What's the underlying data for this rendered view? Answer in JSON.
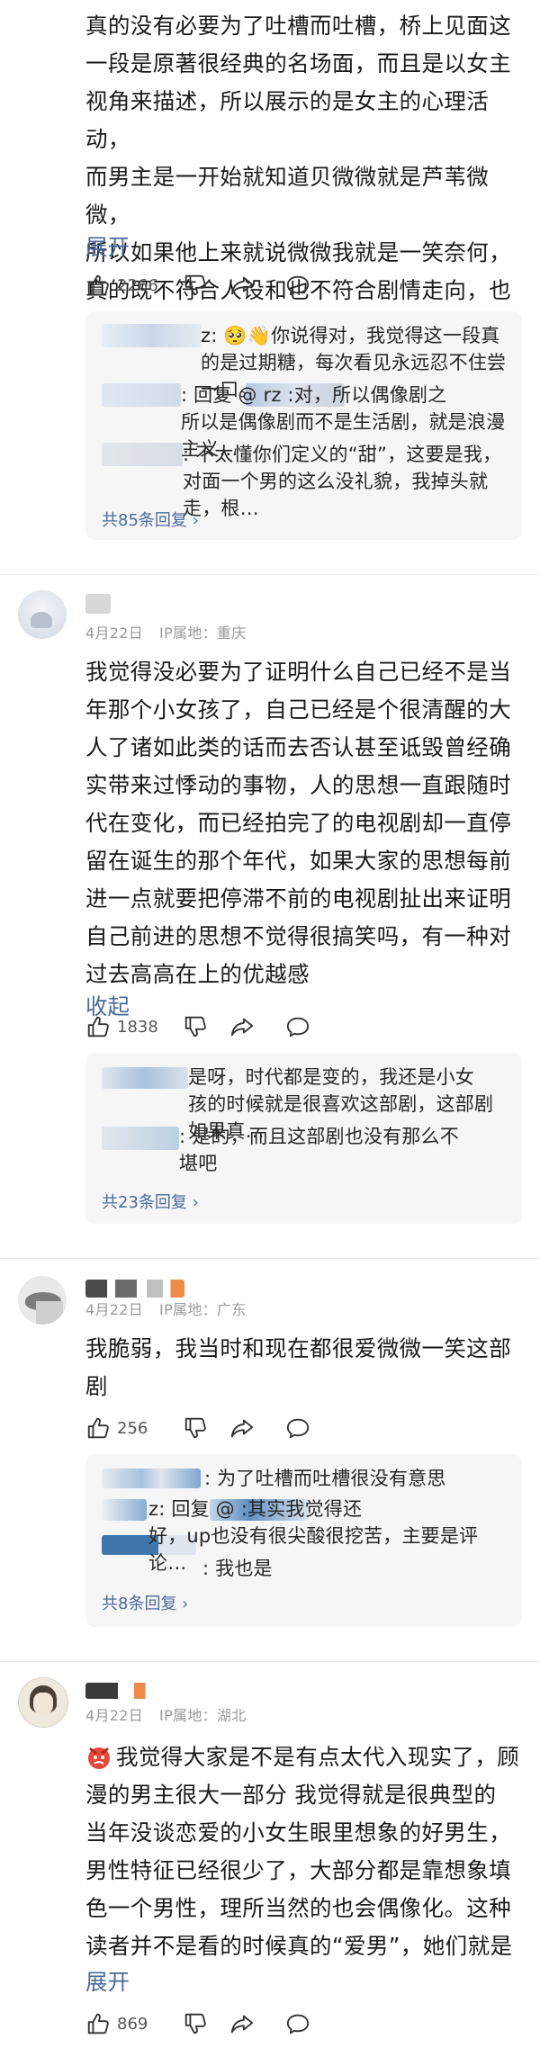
{
  "comments": [
    {
      "body": "真的没有必要为了吐槽而吐槽，桥上见面这\n一段是原著很经典的名场面，而且是以女主\n视角来描述，所以展示的是女主的心理活动，\n而男主是一开始就知道贝微微就是芦苇微微，\n所以如果他上来就说微微我就是一笑奈何，\n真的既不符合人设和也不符合剧情走向，也",
      "toggle": "展开",
      "likes": "2266",
      "replies": [
        "z: 🥺👋你说得对，我觉得这一段真\n的是过期糖，每次看见永远忍不住尝一口。",
        ": 回复 @        rz :对，所以偶像剧之\n所以是偶像剧而不是生活剧，就是浪漫主义…",
        ": 不太懂你们定义的“甜”，这要是我，\n对面一个男的这么没礼貌，我掉头就走，根…"
      ],
      "more": "共85条回复 ›"
    },
    {
      "date": "4月22日",
      "ip": "IP属地：重庆",
      "body": "我觉得没必要为了证明什么自己已经不是当\n年那个小女孩了，自己已经是个很清醒的大\n人了诸如此类的话而去否认甚至诋毁曾经确\n实带来过悸动的事物，人的思想一直跟随时\n代在变化，而已经拍完了的电视剧却一直停\n留在诞生的那个年代，如果大家的思想每前\n进一点就要把停滞不前的电视剧扯出来证明\n自己前进的思想不觉得很搞笑吗，有一种对\n过去高高在上的优越感",
      "toggle": "收起",
      "likes": "1838",
      "replies": [
        "是呀，时代都是变的，我还是小女\n孩的时候就是很喜欢这部剧，这部剧如果真…",
        ": 是的，而且这部剧也没有那么不\n堪吧"
      ],
      "more": "共23条回复 ›"
    },
    {
      "date": "4月22日",
      "ip": "IP属地：广东",
      "body": "我脆弱，我当时和现在都很爱微微一笑这部\n剧",
      "likes": "256",
      "replies": [
        ": 为了吐槽而吐槽很没有意思",
        "z: 回复 @                 :其实我觉得还\n好，up也没有很尖酸很挖苦，主要是评论…",
        ": 我也是"
      ],
      "more": "共8条回复 ›"
    },
    {
      "date": "4月22日",
      "ip": "IP属地：湖北",
      "body": "我觉得大家是不是有点太代入现实了，顾\n漫的男主很大一部分 我觉得就是很典型的\n当年没谈恋爱的小女生眼里想象的好男生，\n男性特征已经很少了，大部分都是靠想象填\n色一个男性，理所当然的也会偶像化。这种\n读者并不是看的时候真的“爱男”，她们就是",
      "toggle": "展开",
      "likes": "869"
    }
  ],
  "icons": {
    "like": "thumbs-up-icon",
    "dislike": "thumbs-down-icon",
    "share": "share-arrow-icon",
    "comment": "speech-bubble-icon",
    "sticker": "angry-face-sticker-icon"
  },
  "colors": {
    "link": "#4a6a9a",
    "reply_bg": "#f6f6f7",
    "meta": "#9a9a9a"
  }
}
